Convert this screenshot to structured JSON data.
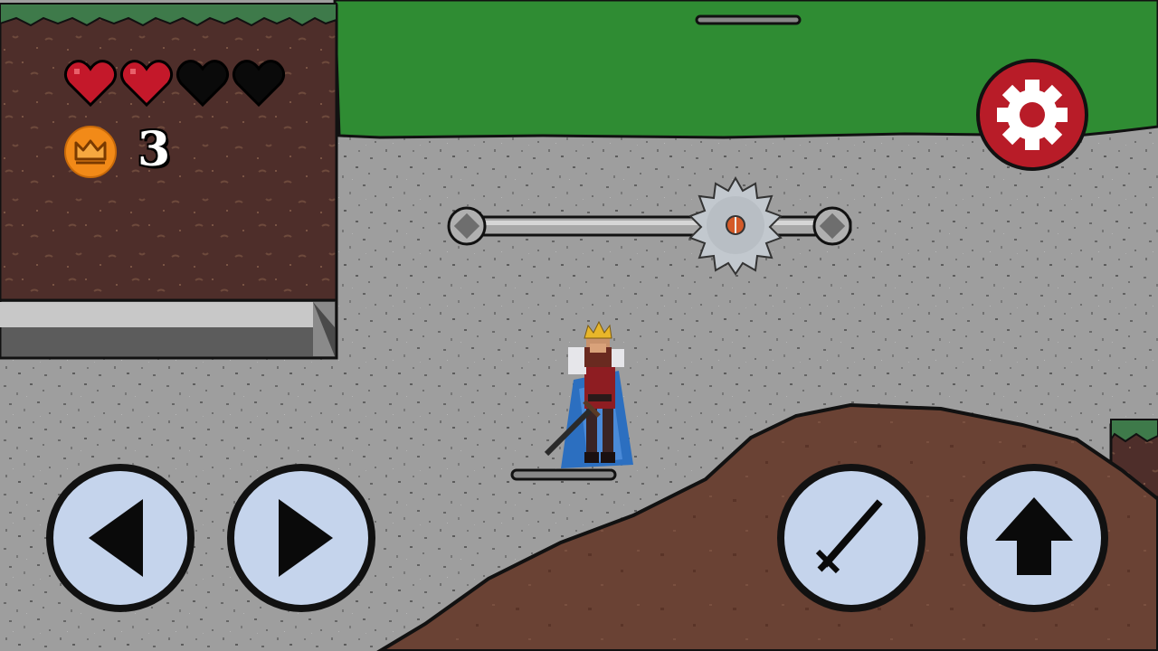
{
  "hud": {
    "hearts": {
      "max": 4,
      "current": 2
    },
    "coins": {
      "icon": "crown-coin-icon",
      "count": "3"
    }
  },
  "controls": {
    "settings": {
      "icon": "gear-icon"
    },
    "move_left": {
      "icon": "arrow-left-icon"
    },
    "move_right": {
      "icon": "arrow-right-icon"
    },
    "attack": {
      "icon": "sword-icon"
    },
    "jump": {
      "icon": "arrow-up-icon"
    }
  },
  "colors": {
    "heart_full": "#c4182a",
    "heart_empty": "#0a0a0a",
    "coin": "#f28a18",
    "settings_bg": "#b81c28",
    "button_fill": "#c5d4ec",
    "grass": "#2e8a34",
    "stone": "#9c9c9c",
    "dirt": "#6b4034"
  }
}
